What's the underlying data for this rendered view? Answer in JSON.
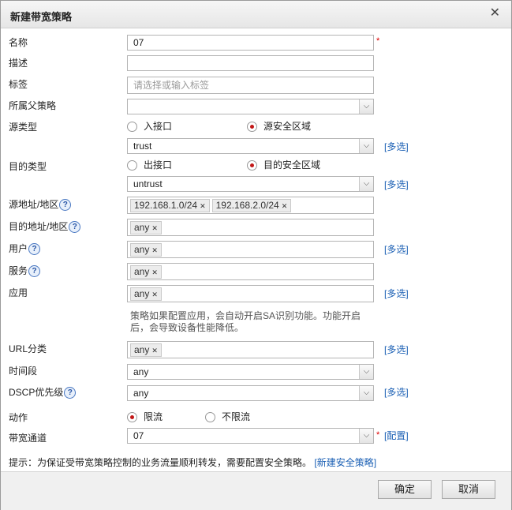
{
  "dialog": {
    "title": "新建带宽策略",
    "close_symbol": "✕"
  },
  "fields": {
    "name": {
      "label": "名称",
      "value": "07"
    },
    "description": {
      "label": "描述",
      "value": ""
    },
    "tags": {
      "label": "标签",
      "placeholder": "请选择或输入标签"
    },
    "parent_policy": {
      "label": "所属父策略",
      "value": ""
    },
    "source_type": {
      "label": "源类型",
      "option1": "入接口",
      "option2": "源安全区域",
      "selected": "源安全区域"
    },
    "source_zone": {
      "value": "trust",
      "multi_link": "[多选]"
    },
    "dest_type": {
      "label": "目的类型",
      "option1": "出接口",
      "option2": "目的安全区域",
      "selected": "目的安全区域"
    },
    "dest_zone": {
      "value": "untrust",
      "multi_link": "[多选]"
    },
    "source_address": {
      "label": "源地址/地区",
      "tags": [
        "192.168.1.0/24",
        "192.168.2.0/24"
      ]
    },
    "dest_address": {
      "label": "目的地址/地区",
      "tags": [
        "any"
      ]
    },
    "user": {
      "label": "用户",
      "tags": [
        "any"
      ],
      "multi_link": "[多选]"
    },
    "service": {
      "label": "服务",
      "tags": [
        "any"
      ]
    },
    "application": {
      "label": "应用",
      "tags": [
        "any"
      ],
      "multi_link": "[多选]",
      "note": "策略如果配置应用，会自动开启SA识别功能。功能开启后，会导致设备性能降低。"
    },
    "url_category": {
      "label": "URL分类",
      "tags": [
        "any"
      ],
      "multi_link": "[多选]"
    },
    "time_range": {
      "label": "时间段",
      "value": "any"
    },
    "dscp": {
      "label": "DSCP优先级",
      "value": "any",
      "multi_link": "[多选]"
    },
    "action": {
      "label": "动作",
      "option1": "限流",
      "option2": "不限流",
      "selected": "限流"
    },
    "bandwidth_channel": {
      "label": "带宽通道",
      "value": "07",
      "config_link": "[配置]"
    }
  },
  "tip": {
    "text": "提示：为保证受带宽策略控制的业务流量顺利转发，需要配置安全策略。",
    "link": "[新建安全策略]"
  },
  "buttons": {
    "ok": "确定",
    "cancel": "取消"
  },
  "icons": {
    "help": "?",
    "tag_remove": "✕",
    "dropdown": "⌵"
  },
  "colors": {
    "link": "#1a5fb4",
    "required": "#dd0000",
    "radio_selected": "#c21818"
  }
}
